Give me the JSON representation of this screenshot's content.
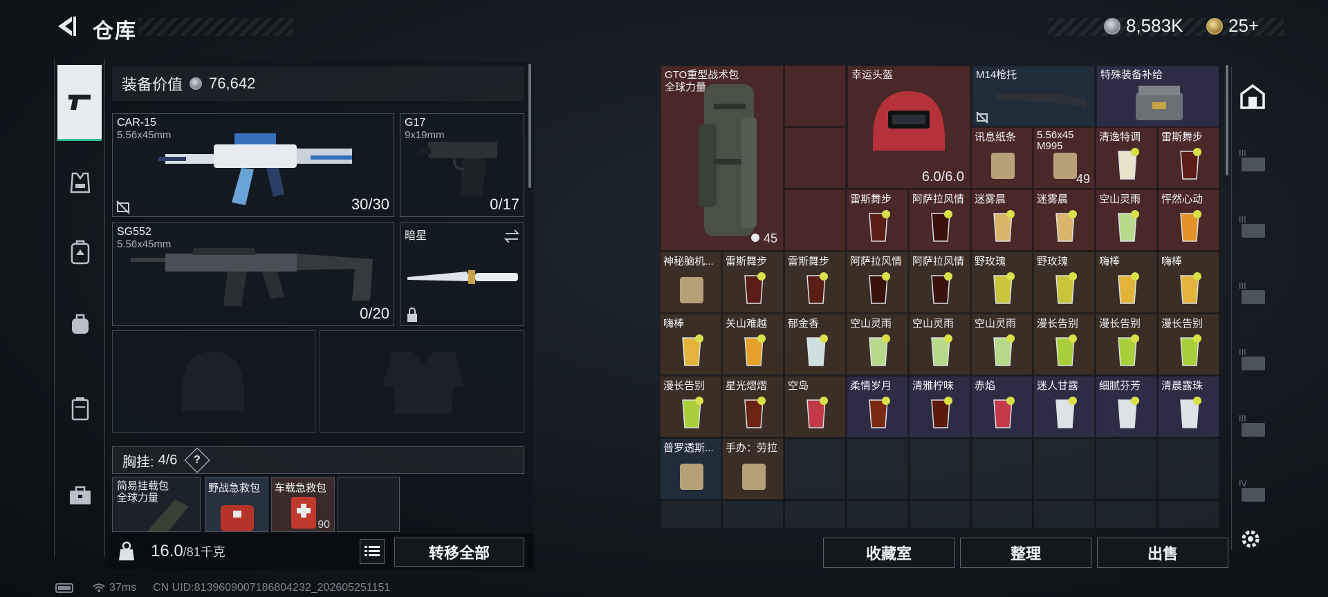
{
  "header": {
    "title": "仓库",
    "silver_amount": "8,583K",
    "gold_amount": "25+"
  },
  "equipment": {
    "value_label": "装备价值",
    "value": "76,642",
    "weapons": [
      {
        "name": "CAR-15",
        "caliber": "5.56x45mm",
        "ammo": "30/30"
      },
      {
        "name": "G17",
        "caliber": "9x19mm",
        "ammo": "0/17"
      },
      {
        "name": "SG552",
        "caliber": "5.56x45mm",
        "ammo": "0/20"
      },
      {
        "name": "暗星",
        "caliber": "",
        "ammo": ""
      }
    ],
    "chest_rig": {
      "label": "胸挂:",
      "count": "4/6",
      "help": "?"
    },
    "chest_items": [
      {
        "name": "简易挂载包",
        "sub": "全球力量"
      },
      {
        "name": "野战急救包",
        "sub": ""
      },
      {
        "name": "车载急救包",
        "sub": "",
        "count": "90"
      },
      {
        "name": "",
        "sub": ""
      }
    ],
    "weight": {
      "current": "16.0",
      "max": "/81千克"
    },
    "transfer_all": "转移全部"
  },
  "inventory": {
    "big_items": [
      {
        "name": "GTO重型战术包",
        "sub": "全球力量",
        "count": "45"
      },
      {
        "name": "幸运头盔",
        "durability": "6.0/6.0"
      },
      {
        "name": "M14枪托"
      },
      {
        "name": "特殊装备补给"
      }
    ],
    "cells": [
      {
        "name": "讯息纸条"
      },
      {
        "name": "5.56x45",
        "sub": "M995",
        "count": "49"
      },
      {
        "name": "清逸特调"
      },
      {
        "name": "雷斯舞步"
      },
      {
        "name": "雷斯舞步"
      },
      {
        "name": "阿萨拉风情"
      },
      {
        "name": "迷雾晨"
      },
      {
        "name": "迷雾晨"
      },
      {
        "name": "空山灵雨"
      },
      {
        "name": "怦然心动"
      },
      {
        "name": "神秘脑机..."
      },
      {
        "name": "雷斯舞步"
      },
      {
        "name": "雷斯舞步"
      },
      {
        "name": "阿萨拉风情"
      },
      {
        "name": "阿萨拉风情"
      },
      {
        "name": "野玫瑰"
      },
      {
        "name": "野玫瑰"
      },
      {
        "name": "嗨棒"
      },
      {
        "name": "嗨棒"
      },
      {
        "name": "嗨棒"
      },
      {
        "name": "关山难越"
      },
      {
        "name": "郁金香"
      },
      {
        "name": "空山灵雨"
      },
      {
        "name": "空山灵雨"
      },
      {
        "name": "空山灵雨"
      },
      {
        "name": "漫长告别"
      },
      {
        "name": "漫长告别"
      },
      {
        "name": "漫长告别"
      },
      {
        "name": "漫长告别"
      },
      {
        "name": "星光熠熠"
      },
      {
        "name": "空岛"
      },
      {
        "name": "柔情岁月"
      },
      {
        "name": "清雅柠味"
      },
      {
        "name": "赤焰"
      },
      {
        "name": "迷人甘露"
      },
      {
        "name": "细腻芬芳"
      },
      {
        "name": "清晨露珠"
      },
      {
        "name": "普罗透斯..."
      },
      {
        "name": "手办：劳拉"
      }
    ]
  },
  "actions": {
    "collection": "收藏室",
    "organize": "整理",
    "sell": "出售"
  },
  "status": {
    "ping": "37ms",
    "uid": "CN UID:8139609007186804232_202605251151"
  },
  "colors": {
    "accent_green": "#2fbf8f",
    "red_cell": "#4a2828",
    "purple_cell": "#2e2c45"
  },
  "icons": {
    "nav": [
      "pistol-icon",
      "vest-icon",
      "backpack-icon",
      "bag-icon",
      "case-icon",
      "toolbox-icon"
    ],
    "rail": [
      "safehouse-icon",
      "rank-iii-icon",
      "rank-iv-icon",
      "gear-icon"
    ]
  }
}
